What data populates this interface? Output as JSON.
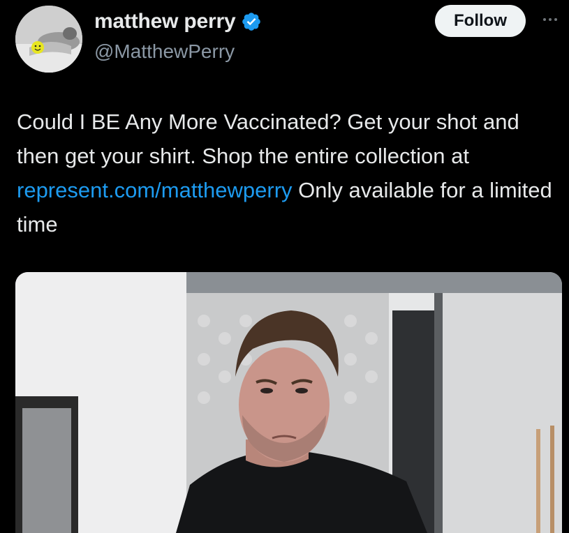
{
  "author": {
    "name": "matthew perry",
    "handle": "@MatthewPerry",
    "verified": true
  },
  "actions": {
    "follow_label": "Follow",
    "more_icon": "more-horizontal-icon"
  },
  "tweet": {
    "text_before": "Could I BE Any More Vaccinated? Get your shot and then get your shirt. Shop the entire collection at ",
    "link": "represent.com/matthewperry",
    "text_after": " Only available for a limited time"
  },
  "colors": {
    "background": "#000000",
    "text": "#e7e9ea",
    "secondary": "#8b98a5",
    "link": "#1d9bf0",
    "verified_badge": "#1d9bf0",
    "follow_bg": "#eff3f4"
  }
}
